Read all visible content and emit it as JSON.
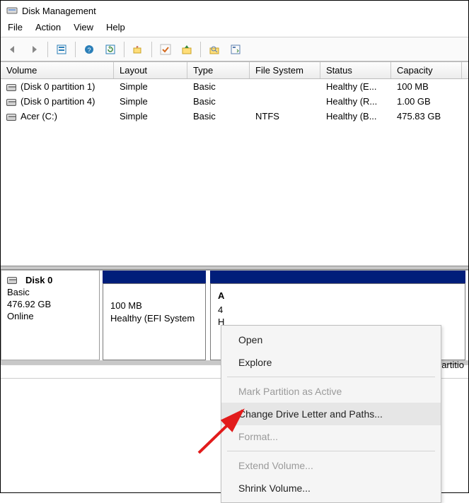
{
  "window": {
    "title": "Disk Management"
  },
  "menu": {
    "file": "File",
    "action": "Action",
    "view": "View",
    "help": "Help"
  },
  "columns": {
    "volume": "Volume",
    "layout": "Layout",
    "type": "Type",
    "fs": "File System",
    "status": "Status",
    "capacity": "Capacity"
  },
  "volumes": [
    {
      "name": "(Disk 0 partition 1)",
      "layout": "Simple",
      "type": "Basic",
      "fs": "",
      "status": "Healthy (E...",
      "capacity": "100 MB"
    },
    {
      "name": "(Disk 0 partition 4)",
      "layout": "Simple",
      "type": "Basic",
      "fs": "",
      "status": "Healthy (R...",
      "capacity": "1.00 GB"
    },
    {
      "name": "Acer (C:)",
      "layout": "Simple",
      "type": "Basic",
      "fs": "NTFS",
      "status": "Healthy (B...",
      "capacity": "475.83 GB"
    }
  ],
  "disk": {
    "name": "Disk 0",
    "type": "Basic",
    "size": "476.92 GB",
    "state": "Online",
    "parts": {
      "p1_size": "100 MB",
      "p1_status": "Healthy (EFI System",
      "p2_letter_peek": "A",
      "p2_health_peek": "H",
      "right_peek": "Partitio"
    }
  },
  "context": {
    "open": "Open",
    "explore": "Explore",
    "mark": "Mark Partition as Active",
    "change": "Change Drive Letter and Paths...",
    "format": "Format...",
    "extend": "Extend Volume...",
    "shrink": "Shrink Volume..."
  }
}
